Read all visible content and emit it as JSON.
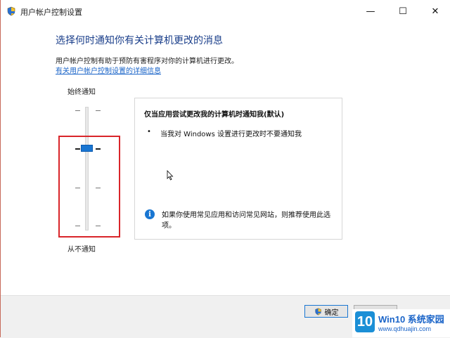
{
  "window": {
    "title": "用户帐户控制设置",
    "minimize_glyph": "—",
    "maximize_glyph": "☐",
    "close_glyph": "✕"
  },
  "main": {
    "heading": "选择何时通知你有关计算机更改的消息",
    "description": "用户帐户控制有助于预防有害程序对你的计算机进行更改。",
    "link": "有关用户帐户控制设置的详细信息"
  },
  "slider": {
    "top_label": "始终通知",
    "bottom_label": "从不通知",
    "levels": 4,
    "selected_level": 3
  },
  "panel": {
    "title": "仅当应用尝试更改我的计算机时通知我(默认)",
    "bullet": "•",
    "bullet_text": "当我对 Windows 设置进行更改时不要通知我",
    "info_glyph": "i",
    "info_text": "如果你使用常见应用和访问常见网站，则推荐使用此选项。"
  },
  "footer": {
    "ok_label": "确定"
  },
  "watermark": {
    "logo_text": "10",
    "line1": "Win10 系统家园",
    "line2": "www.qdhuajin.com"
  },
  "colors": {
    "accent": "#1976d2",
    "heading": "#1a3e8a",
    "link": "#1a64c8",
    "highlight": "#d9252a"
  }
}
